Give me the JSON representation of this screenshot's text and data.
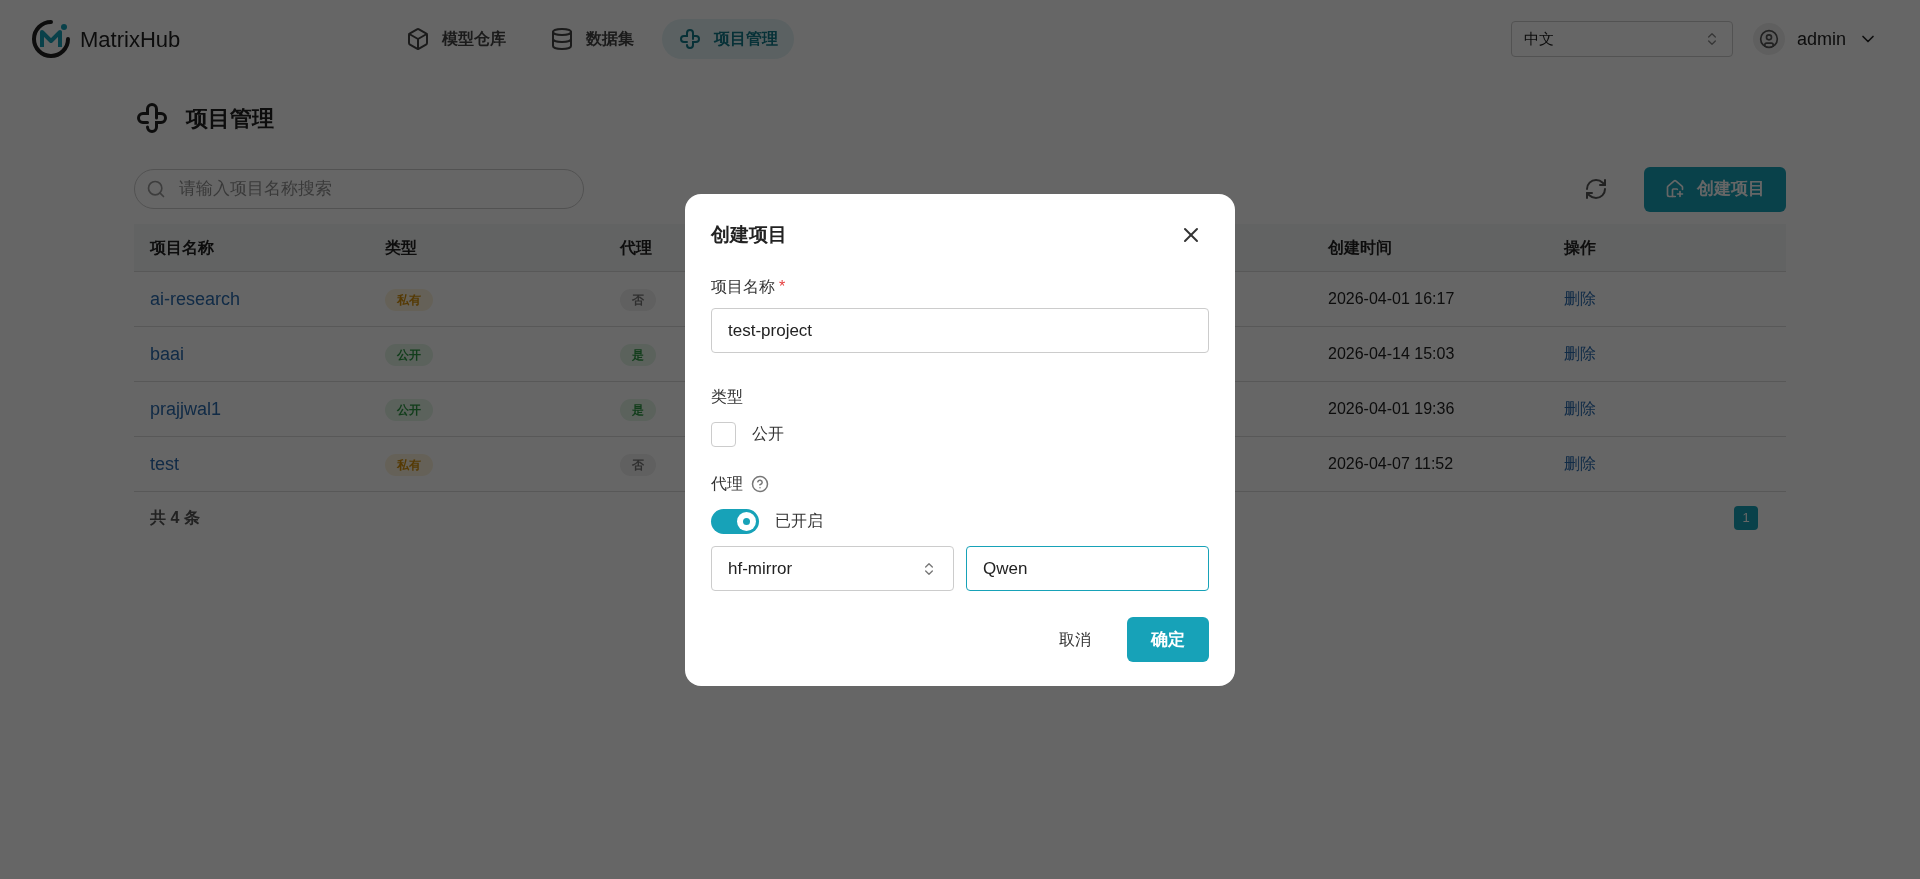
{
  "header": {
    "logo_text": "MatrixHub",
    "nav": [
      {
        "label": "模型仓库",
        "kind": "cube",
        "selected": false
      },
      {
        "label": "数据集",
        "kind": "database",
        "selected": false
      },
      {
        "label": "项目管理",
        "kind": "project",
        "selected": true
      }
    ],
    "language": "中文",
    "user": "admin"
  },
  "page": {
    "title": "项目管理",
    "search": {
      "placeholder": "请输入项目名称搜索"
    },
    "create_button": "创建项目",
    "table": {
      "columns": [
        "项目名称",
        "类型",
        "代理",
        "创建时间",
        "操作"
      ],
      "rows": [
        {
          "name": "ai-research",
          "type": {
            "label": "私有",
            "kind": "private"
          },
          "proxy": {
            "label": "否",
            "kind": "no"
          },
          "created": "2026-04-01 16:17",
          "action": "删除"
        },
        {
          "name": "baai",
          "type": {
            "label": "公开",
            "kind": "public"
          },
          "proxy": {
            "label": "是",
            "kind": "yes"
          },
          "created": "2026-04-14 15:03",
          "action": "删除"
        },
        {
          "name": "prajjwal1",
          "type": {
            "label": "公开",
            "kind": "public"
          },
          "proxy": {
            "label": "是",
            "kind": "yes"
          },
          "created": "2026-04-01 19:36",
          "action": "删除"
        },
        {
          "name": "test",
          "type": {
            "label": "私有",
            "kind": "private"
          },
          "proxy": {
            "label": "否",
            "kind": "no"
          },
          "created": "2026-04-07 11:52",
          "action": "删除"
        }
      ]
    },
    "total": "共 4 条",
    "pagination": [
      {
        "label": "1",
        "selected": true
      }
    ]
  },
  "dialog": {
    "title": "创建项目",
    "name_label": "项目名称",
    "required_mark": "*",
    "name_value": "test-project",
    "type_label": "类型",
    "public": {
      "label": "公开",
      "checked": false
    },
    "proxy_label": "代理",
    "proxy_toggle": {
      "label": "已开启",
      "on": true
    },
    "proxy_source": "hf-mirror",
    "proxy_org": "Qwen",
    "cancel": "取消",
    "confirm": "确定"
  }
}
